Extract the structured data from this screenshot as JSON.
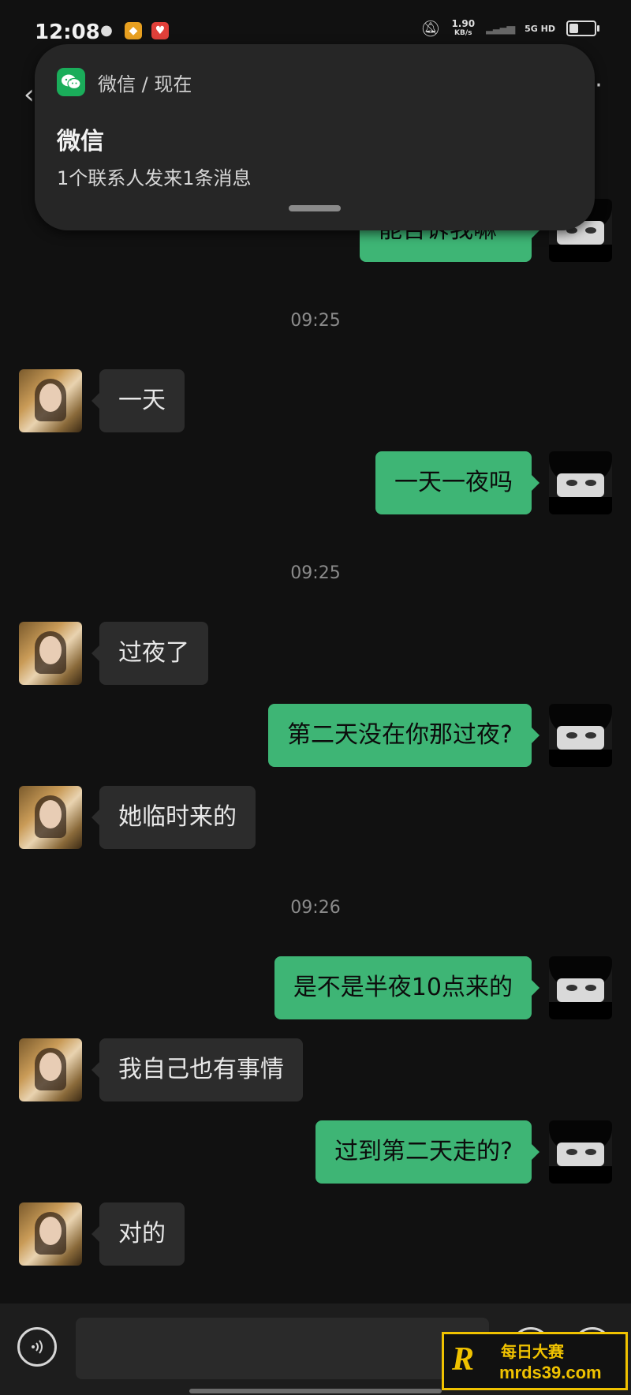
{
  "status_bar": {
    "time": "12:08",
    "net_speed": "1.90",
    "net_speed_unit": "KB/s",
    "network": "5G HD",
    "battery_level": 0.35
  },
  "notification": {
    "app": "微信 / 现在",
    "title": "微信",
    "body": "1个联系人发来1条消息"
  },
  "chat": {
    "partial_message": "能否诉我嘛",
    "timestamps": [
      "09:25",
      "09:25",
      "09:26"
    ],
    "messages": [
      {
        "side": "left",
        "text": "一天"
      },
      {
        "side": "right",
        "text": "一天一夜吗"
      },
      {
        "side": "left",
        "text": "过夜了"
      },
      {
        "side": "right",
        "text": "第二天没在你那过夜?"
      },
      {
        "side": "left",
        "text": "她临时来的"
      },
      {
        "side": "right",
        "text": "是不是半夜10点来的"
      },
      {
        "side": "left",
        "text": "我自己也有事情"
      },
      {
        "side": "right",
        "text": "过到第二天走的?"
      },
      {
        "side": "left",
        "text": "对的"
      }
    ]
  },
  "input_bar": {
    "plus": "+"
  },
  "watermark": {
    "logo": "R",
    "name": "每日大赛",
    "url": "mrds39.com"
  },
  "colors": {
    "bubble_right": "#3eb575",
    "bubble_left": "#2c2c2c",
    "background": "#111111",
    "wechat": "#1aad5a",
    "watermark": "#f0c200"
  }
}
